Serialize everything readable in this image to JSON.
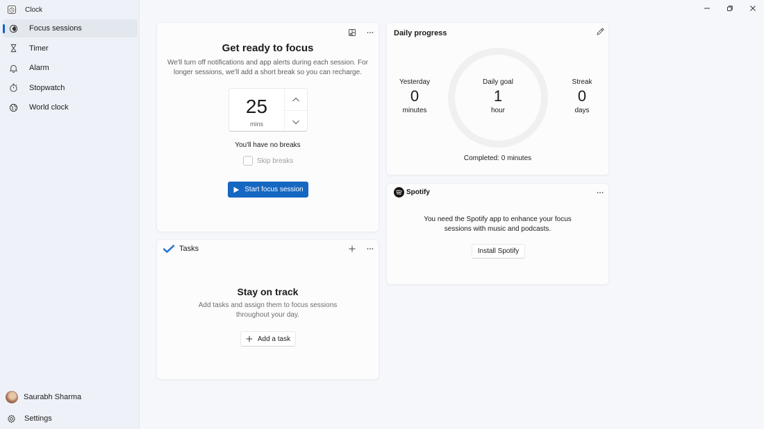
{
  "app": {
    "title": "Clock"
  },
  "window_controls": {
    "minimize": "minimize",
    "restore": "restore",
    "close": "close"
  },
  "sidebar": {
    "items": [
      {
        "label": "Focus sessions",
        "icon": "focus-icon",
        "active": true
      },
      {
        "label": "Timer",
        "icon": "hourglass-icon",
        "active": false
      },
      {
        "label": "Alarm",
        "icon": "bell-icon",
        "active": false
      },
      {
        "label": "Stopwatch",
        "icon": "stopwatch-icon",
        "active": false
      },
      {
        "label": "World clock",
        "icon": "globe-icon",
        "active": false
      }
    ],
    "user": {
      "name": "Saurabh Sharma"
    },
    "settings_label": "Settings"
  },
  "focus": {
    "title": "Get ready to focus",
    "description": "We'll turn off notifications and app alerts during each session. For longer sessions, we'll add a short break so you can recharge.",
    "duration_value": "25",
    "duration_unit": "mins",
    "breaks_text": "You'll have no breaks",
    "skip_breaks_label": "Skip breaks",
    "skip_breaks_checked": false,
    "start_label": "Start focus session",
    "accent_color": "#1667c1"
  },
  "tasks": {
    "header": "Tasks",
    "empty_title": "Stay on track",
    "empty_description": "Add tasks and assign them to focus sessions throughout your day.",
    "add_label": "Add a task"
  },
  "progress": {
    "header": "Daily progress",
    "yesterday": {
      "label": "Yesterday",
      "value": "0",
      "unit": "minutes"
    },
    "goal": {
      "label": "Daily goal",
      "value": "1",
      "unit": "hour"
    },
    "streak": {
      "label": "Streak",
      "value": "0",
      "unit": "days"
    },
    "completed_text": "Completed: 0 minutes",
    "completed_fraction": 0
  },
  "spotify": {
    "brand": "Spotify",
    "description": "You need the Spotify app to enhance your focus sessions with music and podcasts.",
    "install_label": "Install Spotify"
  }
}
